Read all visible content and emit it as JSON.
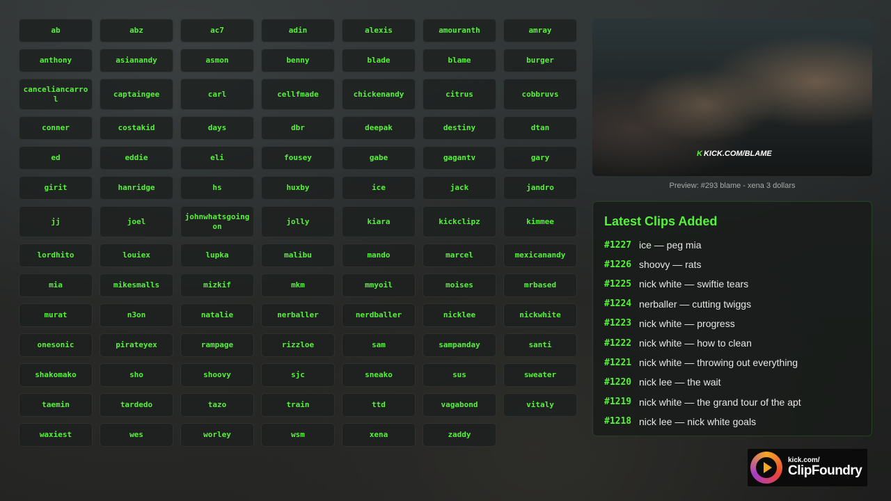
{
  "streamers": [
    "ab",
    "abz",
    "ac7",
    "adin",
    "alexis",
    "amouranth",
    "amray",
    "anthony",
    "asianandy",
    "asmon",
    "benny",
    "blade",
    "blame",
    "burger",
    "canceliancarrol",
    "captaingee",
    "carl",
    "cellfmade",
    "chickenandy",
    "citrus",
    "cobbruvs",
    "conner",
    "costakid",
    "days",
    "dbr",
    "deepak",
    "destiny",
    "dtan",
    "ed",
    "eddie",
    "eli",
    "fousey",
    "gabe",
    "gagantv",
    "gary",
    "girit",
    "hanridge",
    "hs",
    "huxby",
    "ice",
    "jack",
    "jandro",
    "jj",
    "joel",
    "johnwhatsgoingon",
    "jolly",
    "kiara",
    "kickclipz",
    "kimmee",
    "lordhito",
    "louiex",
    "lupka",
    "malibu",
    "mando",
    "marcel",
    "mexicanandy",
    "mia",
    "mikesmalls",
    "mizkif",
    "mkm",
    "mmyoil",
    "moises",
    "mrbased",
    "murat",
    "n3on",
    "natalie",
    "nerballer",
    "nerdballer",
    "nicklee",
    "nickwhite",
    "onesonic",
    "pirateyex",
    "rampage",
    "rizzloe",
    "sam",
    "sampanday",
    "santi",
    "shakomako",
    "sho",
    "shoovy",
    "sjc",
    "sneako",
    "sus",
    "sweater",
    "taemin",
    "tardedo",
    "tazo",
    "train",
    "ttd",
    "vagabond",
    "vitaly",
    "waxiest",
    "wes",
    "worley",
    "wsm",
    "xena",
    "zaddy"
  ],
  "preview": {
    "watermark_brand": "K",
    "watermark_text": "KICK.COM/BLAME",
    "caption": "Preview: #293 blame - xena 3 dollars"
  },
  "clips": {
    "title": "Latest Clips Added",
    "items": [
      {
        "num": "#1227",
        "text": "ice — peg mia"
      },
      {
        "num": "#1226",
        "text": "shoovy — rats"
      },
      {
        "num": "#1225",
        "text": "nick white — swiftie tears"
      },
      {
        "num": "#1224",
        "text": "nerballer — cutting twiggs"
      },
      {
        "num": "#1223",
        "text": "nick white — progress"
      },
      {
        "num": "#1222",
        "text": "nick white — how to clean"
      },
      {
        "num": "#1221",
        "text": "nick white — throwing out everything"
      },
      {
        "num": "#1220",
        "text": "nick lee — the wait"
      },
      {
        "num": "#1219",
        "text": "nick white — the grand tour of the apt"
      },
      {
        "num": "#1218",
        "text": "nick lee — nick white goals"
      }
    ]
  },
  "logo": {
    "small": "kick.com/",
    "big": "ClipFoundry"
  },
  "colors": {
    "accent": "#56f23a",
    "panel": "#181c1a"
  }
}
